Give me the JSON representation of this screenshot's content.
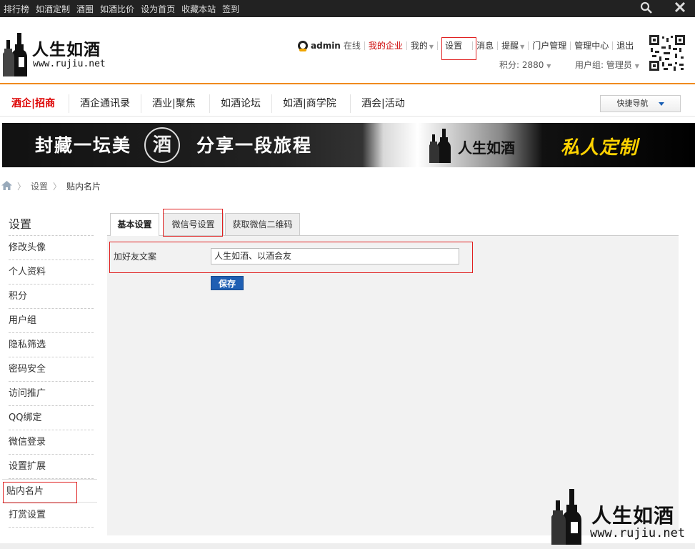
{
  "topbar": {
    "links": [
      "排行榜",
      "如酒定制",
      "酒圈",
      "如酒比价",
      "设为首页",
      "收藏本站",
      "签到"
    ],
    "icons": [
      "search-icon",
      "close-icon"
    ]
  },
  "header": {
    "brand": "人生如酒",
    "url": "www.rujiu.net",
    "username": "admin",
    "online": "在线",
    "my_company": "我的企业",
    "mine": "我的",
    "settings": "设置",
    "messages": "消息",
    "reminders": "提醒",
    "portal_admin": "门户管理",
    "admin_center": "管理中心",
    "logout": "退出",
    "points": "积分: 2880",
    "user_group": "用户组: 管理员"
  },
  "nav": {
    "items": [
      "酒企|招商",
      "酒企通讯录",
      "酒业|聚焦",
      "如酒论坛",
      "如酒|商学院",
      "酒会|活动"
    ],
    "quick_nav": "快捷导航"
  },
  "banner": {
    "slogan_left": "封藏一坛美",
    "seal": "酒",
    "slogan_right": "分享一段旅程",
    "brand": "人生如酒",
    "tagline": "私人定制"
  },
  "breadcrumb": {
    "items": [
      "设置",
      "贴内名片"
    ]
  },
  "sidebar": {
    "title": "设置",
    "items": [
      "修改头像",
      "个人资料",
      "积分",
      "用户组",
      "隐私筛选",
      "密码安全",
      "访问推广",
      "QQ绑定",
      "微信登录",
      "设置扩展",
      "贴内名片",
      "打赏设置"
    ],
    "active": "贴内名片"
  },
  "content": {
    "tabs": [
      "基本设置",
      "微信号设置",
      "获取微信二维码"
    ],
    "active_tab": "基本设置",
    "field_label": "加好友文案",
    "field_value": "人生如酒、以酒会友",
    "save_label": "保存"
  },
  "watermark": {
    "brand": "人生如酒",
    "url": "www.rujiu.net"
  },
  "colors": {
    "accent_orange": "#f08a1e",
    "highlight_red": "#e02020",
    "button_blue": "#1f5fb3"
  }
}
